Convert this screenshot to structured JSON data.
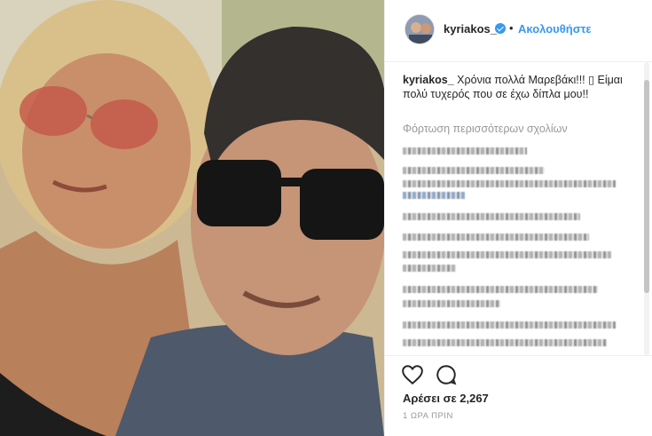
{
  "post": {
    "username": "kyriakos_",
    "separator": "•",
    "follow_label": "Ακολουθήστε",
    "caption_username": "kyriakos_",
    "caption_text": "Χρόνια πολλά Μαρεβάκι!!! ▯ Είμαι πολύ τυχερός που σε έχω δίπλα μου!!",
    "load_more": "Φόρτωση περισσότερων σχολίων",
    "likes": "Αρέσει σε 2,267",
    "timestamp": "1 ΩΡΑ ΠΡΙΝ"
  },
  "icons": {
    "verified": "verified-badge-icon",
    "like": "heart-icon",
    "comment": "comment-icon"
  },
  "colors": {
    "accent": "#3897f0",
    "text": "#262626",
    "muted": "#999999"
  }
}
